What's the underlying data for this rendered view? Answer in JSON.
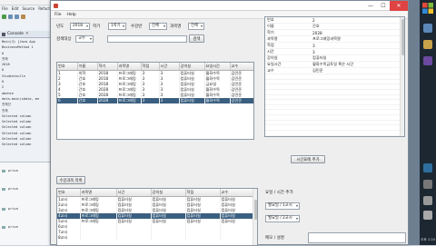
{
  "ide": {
    "menu": [
      "File",
      "Edit",
      "Source",
      "Refactor"
    ],
    "console_tab": "Console",
    "console_lines": [
      "Main(3) [Java App",
      "BusinessMethod 1",
      "0",
      "전체",
      "2018",
      "0",
      "Studentnulle",
      "0",
      "2",
      "abehce",
      "data.main(sdata, me",
      "전체선",
      "",
      "",
      "전체",
      "Selected column",
      "Selected column",
      "Selected column",
      "Selected column",
      "Selected column",
      "Selected column"
    ],
    "lower_lines": [
      "priva",
      "priva",
      "priva",
      "priva"
    ]
  },
  "window": {
    "title": "",
    "menu": [
      "File",
      "Help"
    ]
  },
  "filters": {
    "year_label": "년도",
    "year_value": "2018",
    "semester_label": "학기",
    "semester_value": "1학기",
    "class_label": "수강반",
    "class_value": "전체",
    "subject_label": "과목명",
    "subject_value": "전체",
    "search_label": "검색대상",
    "search_value": "교수",
    "search_button": "검색"
  },
  "top_table": {
    "headers": [
      "번호",
      "이름",
      "학기",
      "과목명",
      "학점",
      "시간",
      "강의실",
      "요일시간",
      "교수"
    ],
    "rows": [
      [
        "1",
        "의학",
        "2018",
        "프로그래밍",
        "3",
        "3",
        "컴퓨터실",
        "월화수목",
        "김민준"
      ],
      [
        "2",
        "간호",
        "2018",
        "프로그래밍",
        "3",
        "3",
        "컴퓨터실",
        "월화수목",
        "김민준"
      ],
      [
        "3",
        "간호",
        "2018",
        "프로그래밍",
        "3",
        "3",
        "컴퓨터실",
        "금요일",
        "김민준"
      ],
      [
        "4",
        "간호",
        "2028",
        "프로그래밍",
        "3",
        "3",
        "컴퓨터실",
        "월화수목",
        "김민준"
      ],
      [
        "5",
        "간호",
        "2028",
        "프로그래밍",
        "3",
        "3",
        "컴퓨터실",
        "월화수목",
        "김민준"
      ],
      [
        "6",
        "간호",
        "2028",
        "프로그래밍",
        "3",
        "3",
        "컴퓨터실",
        "월화수목",
        "김민준"
      ]
    ],
    "selected_row": 5
  },
  "detail": {
    "rows": [
      [
        "번호",
        "2"
      ],
      [
        "이름",
        "간호"
      ],
      [
        "학기",
        "2028"
      ],
      [
        "과목명",
        "프로그래밍과목명"
      ],
      [
        "학점",
        "3"
      ],
      [
        "시간",
        "3"
      ],
      [
        "강의실",
        "컴퓨터실"
      ],
      [
        "요일시간",
        "월화수목금토일 혹은 시간"
      ],
      [
        "교수",
        "김민준"
      ],
      [
        "",
        ""
      ],
      [
        "",
        ""
      ],
      [
        "",
        ""
      ],
      [
        "",
        ""
      ],
      [
        "",
        ""
      ],
      [
        "",
        ""
      ],
      [
        "",
        ""
      ],
      [
        "",
        ""
      ],
      [
        "",
        ""
      ],
      [
        "",
        ""
      ],
      [
        "",
        ""
      ],
      [
        "",
        ""
      ],
      [
        "",
        ""
      ],
      [
        "",
        ""
      ]
    ]
  },
  "mid_buttons": {
    "right_button": "시간표에 추가",
    "left_button": "수강과목 목록"
  },
  "bottom_table": {
    "headers": [
      "번호",
      "과목명",
      "시간",
      "강의실",
      "학점",
      "교수"
    ],
    "rows": [
      [
        "1교시",
        "프로그래밍",
        "컴퓨터실",
        "컴퓨터실",
        "컴퓨터실",
        "컴퓨터실"
      ],
      [
        "2교시",
        "프로그래밍",
        "컴퓨터실",
        "컴퓨터실",
        "컴퓨터실",
        "컴퓨터실"
      ],
      [
        "3교시",
        "프로그래밍",
        "컴퓨터실",
        "컴퓨터실",
        "컴퓨터실",
        "컴퓨터실"
      ],
      [
        "4교시",
        "프로그래밍",
        "컴퓨터실",
        "컴퓨터실",
        "컴퓨터실",
        "컴퓨터실"
      ],
      [
        "5교시",
        "프로그래밍",
        "컴퓨터실",
        "컴퓨터실",
        "컴퓨터실",
        "컴퓨터실"
      ],
      [
        "6교시",
        "",
        "",
        "",
        "",
        ""
      ],
      [
        "7교시",
        "",
        "",
        "",
        "",
        ""
      ],
      [
        "8교시",
        "",
        "",
        "",
        "",
        ""
      ]
    ],
    "selected_row": 3
  },
  "right_panel": {
    "label1": "요일 / 시간 추가",
    "combo1": "월요일 / 1교시",
    "combo2": "월요일 / 2교시",
    "memo_label": "메모 / 설명"
  },
  "taskbar": {
    "clock": "오후 1:24"
  }
}
